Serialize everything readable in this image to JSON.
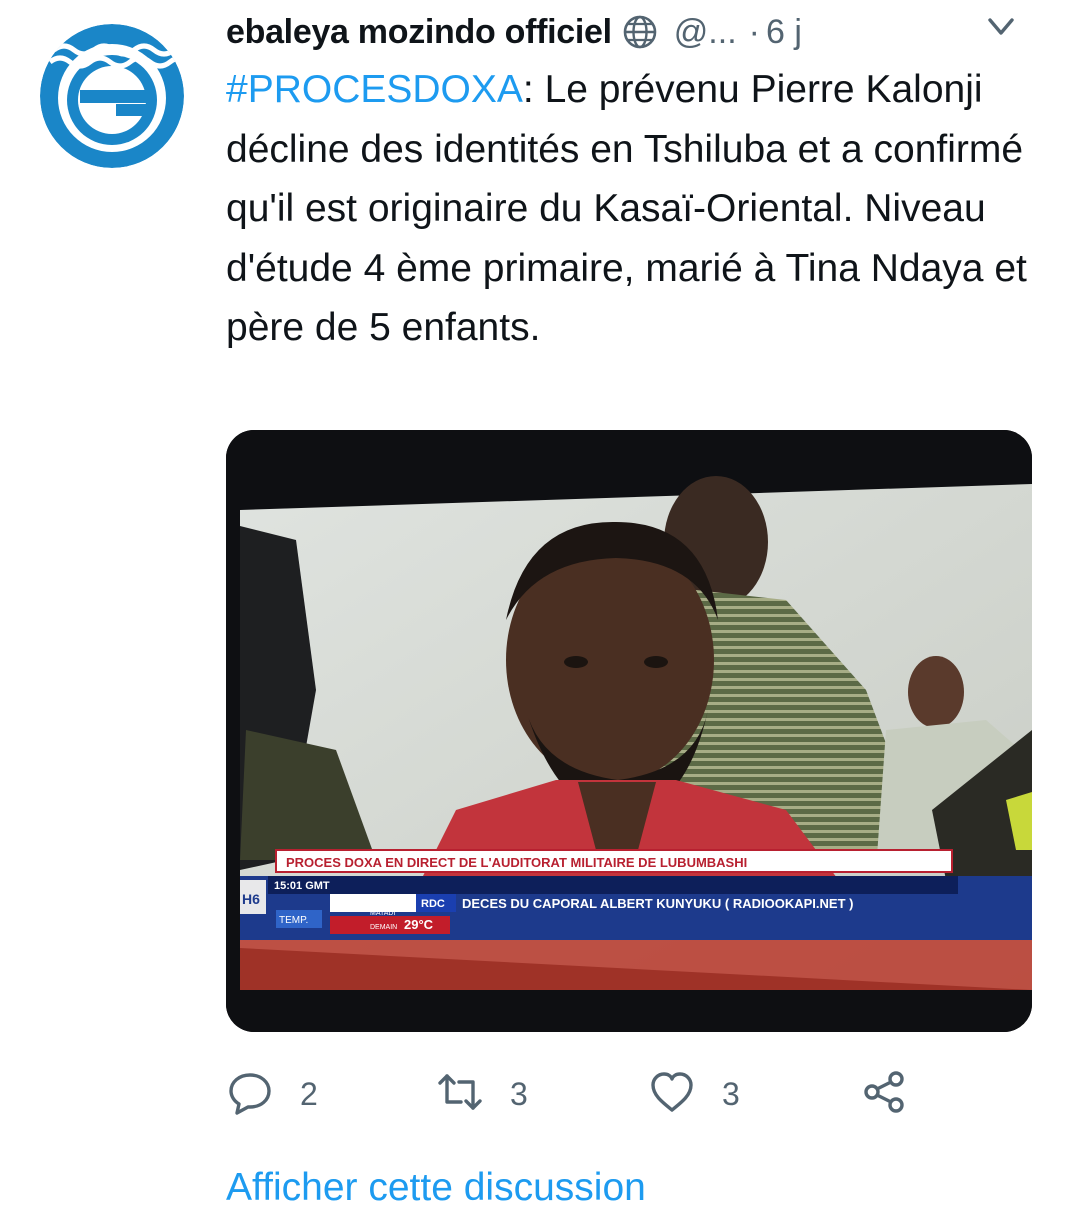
{
  "tweet": {
    "display_name": "ebaleya mozindo officiel",
    "handle": "@...",
    "separator": "·",
    "time": "6 j",
    "hashtag": "#PROCESDOXA",
    "text": ": Le prévenu Pierre Kalonji décline des identités en Tshiluba et a confirmé qu'il est originaire du Kasaï-Oriental. Niveau d'étude 4 ème primaire, marié à Tina Ndaya et père de 5 enfants."
  },
  "media": {
    "ticker_headline": "PROCES DOXA EN DIRECT DE L'AUDITORAT MILITAIRE DE LUBUMBASHI",
    "channel_logo": "H6",
    "clock": "15:01 GMT",
    "region_tag": "RDC",
    "news_line": "DECES DU CAPORAL ALBERT KUNYUKU ( RADIOOKAPI.NET )",
    "temp_label": "TEMP.",
    "weather_city": "MATADI",
    "weather_when": "DEMAIN",
    "weather_value": "29°C"
  },
  "actions": {
    "replies": "2",
    "retweets": "3",
    "likes": "3"
  },
  "footer": {
    "show_thread": "Afficher cette discussion"
  },
  "colors": {
    "accent": "#1d9bf0",
    "text": "#0f1419",
    "secondary": "#536471",
    "logo_blue": "#1a86c8"
  },
  "icons": {
    "avatar": "ebaleya-e-logo",
    "verified_globe": "globe-icon",
    "more": "more-icon",
    "reply": "reply-icon",
    "retweet": "retweet-icon",
    "like": "heart-icon",
    "share": "share-icon"
  }
}
